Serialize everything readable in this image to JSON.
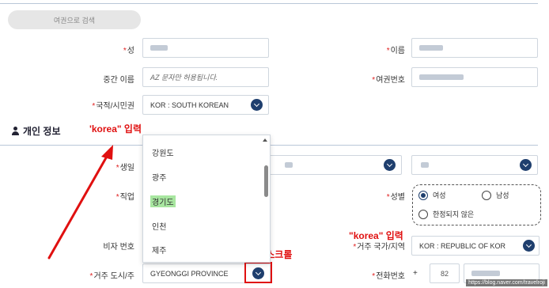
{
  "search_button_label": "여권으로 검색",
  "fields": {
    "surname_label": "성",
    "given_name_label": "이름",
    "middle_name_label": "중간 이름",
    "middle_name_placeholder": "AZ 문자만 허용됩니다.",
    "passport_no_label": "여권번호",
    "nationality_label": "국적/시민권",
    "nationality_value": "KOR : SOUTH KOREAN",
    "birth_label": "생일",
    "job_label": "직업",
    "gender_label": "성별",
    "visa_no_label": "비자 번호",
    "residence_country_label": "거주 국가/지역",
    "residence_country_value": "KOR : REPUBLIC OF KOR",
    "residence_city_label": "거주 도시/주",
    "residence_city_value": "GYEONGGI PROVINCE",
    "phone_label": "전화번호",
    "phone_plus": "+",
    "phone_code": "82"
  },
  "section_title": "개인 정보",
  "gender_options": [
    "여성",
    "남성",
    "한정되지 않은"
  ],
  "gender_selected": "여성",
  "dropdown_items": [
    "강원도",
    "광주",
    "경기도",
    "인천",
    "제주"
  ],
  "dropdown_highlighted": "경기도",
  "annotations": {
    "korea_input_1": "'korea\" 입력",
    "korea_input_2": "\"korea\" 입력",
    "scroll_hint": "화살표 클릭 후 스크롤"
  },
  "watermark": "https://blog.naver.com/travelroji",
  "colors": {
    "accent": "#1f3f6e",
    "annotation_red": "#e01010",
    "highlight_green": "#a8e6a0"
  }
}
